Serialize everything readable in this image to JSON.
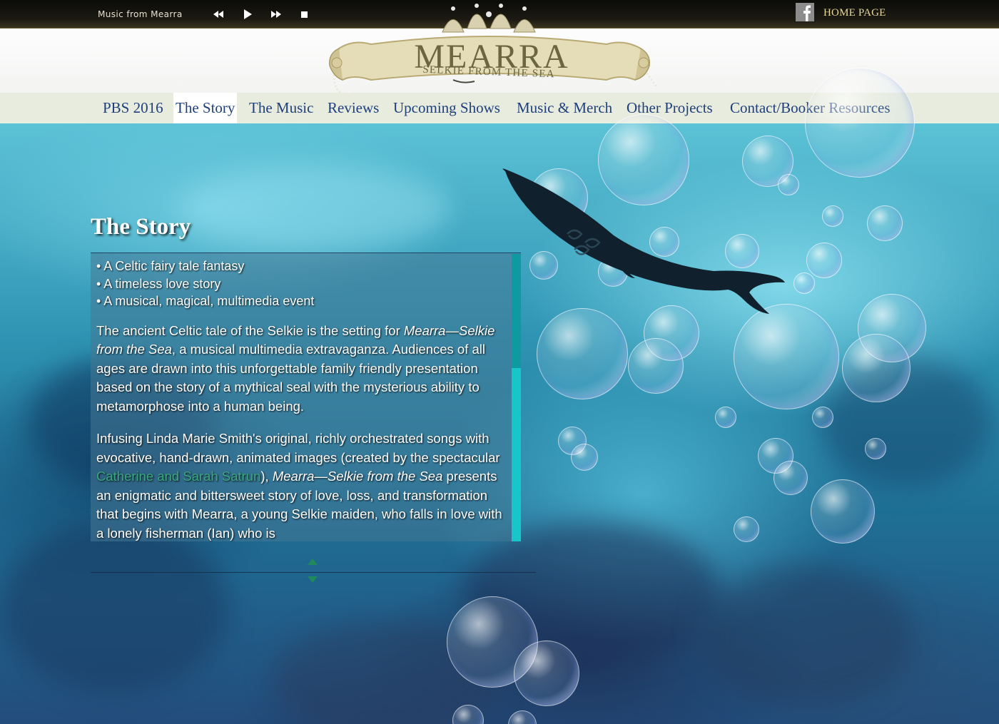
{
  "player": {
    "title": "Music from Mearra",
    "controls": [
      "rewind-icon",
      "play-icon",
      "fast-forward-icon",
      "stop-icon"
    ]
  },
  "topbar": {
    "home_label": "HOME PAGE",
    "social_icon": "facebook-icon"
  },
  "logo": {
    "title": "MEARRA",
    "subtitle": "SELKIE FROM THE SEA"
  },
  "nav": {
    "active": "The Story",
    "items": [
      {
        "label": "PBS 2016"
      },
      {
        "label": "The Story"
      },
      {
        "label": "The Music"
      },
      {
        "label": "Reviews"
      },
      {
        "label": "Upcoming Shows"
      },
      {
        "label": "Music & Merch"
      },
      {
        "label": "Other Projects"
      },
      {
        "label": "Contact/Booker Resources"
      }
    ]
  },
  "story": {
    "heading": "The Story",
    "bullets": [
      "• A Celtic fairy tale fantasy",
      "• A timeless love story",
      "• A musical, magical, multimedia event"
    ],
    "para1": {
      "t1": "The ancient Celtic tale of the Selkie is the setting for ",
      "em1": "Mearra—Selkie from the Sea",
      "t2": ", a musical multimedia extravaganza. Audiences of all ages are drawn into this unforgettable family friendly presentation based on the story of a mythical seal with the mysterious ability to metamorphose into a human being."
    },
    "para2": {
      "t1": "Infusing Linda Marie Smith's original, richly orchestrated songs with evocative, hand-drawn, animated images (created by the spectacular ",
      "link": "Catherine and Sarah Satrun",
      "t2": "), ",
      "em1": "Mearra—Selkie from the Sea",
      "t3": " presents an enigmatic and bittersweet story of love, loss, and transformation that begins with Mearra, a young Selkie maiden, who falls in love with a lonely fisherman (Ian) who is"
    }
  },
  "colors": {
    "nav_text": "#1e3f7a",
    "home_link": "#e9d89a",
    "link": "#3aa77f",
    "scrollbar": "#17c6c9"
  }
}
